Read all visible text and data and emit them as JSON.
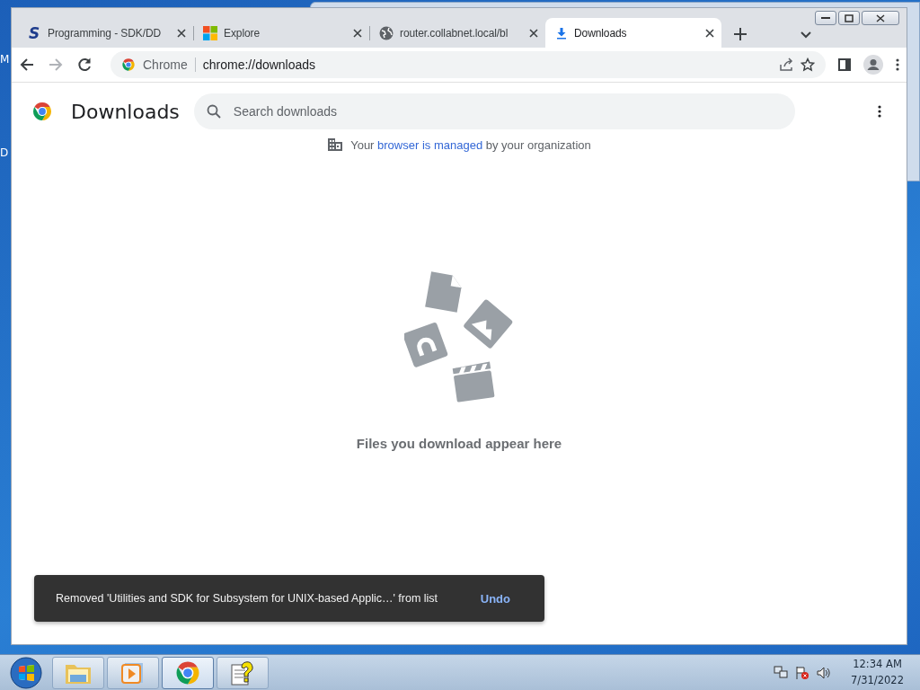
{
  "desktop": {
    "edge_labels": [
      "M",
      "D"
    ]
  },
  "window": {
    "tabs": [
      {
        "title": "Programming - SDK/DD",
        "selected": false,
        "kind": "letter",
        "icon_text": "S"
      },
      {
        "title": "Explore",
        "selected": false,
        "kind": "windows"
      },
      {
        "title": "router.collabnet.local/bl",
        "selected": false,
        "kind": "globe"
      },
      {
        "title": "Downloads",
        "selected": true,
        "kind": "download"
      }
    ],
    "nav": [
      {
        "kind": "back",
        "disabled": false
      },
      {
        "kind": "forward",
        "disabled": true
      },
      {
        "kind": "reload",
        "disabled": false
      }
    ],
    "address_bar": {
      "site_label": "Chrome",
      "url": "chrome://downloads"
    }
  },
  "page": {
    "title": "Downloads",
    "search": {
      "placeholder": "Search downloads"
    },
    "managed_notice": {
      "before": "Your",
      "link": "browser is managed",
      "after": "by your organization"
    },
    "empty_message": "Files you download appear here"
  },
  "toast": {
    "message": "Removed 'Utilities and SDK for Subsystem for UNIX-based Applic…' from list",
    "action": "Undo"
  },
  "taskbar": {
    "apps": [
      {
        "kind": "folder",
        "active": false
      },
      {
        "kind": "media",
        "active": false
      },
      {
        "kind": "chrome",
        "active": true
      },
      {
        "kind": "help",
        "active": false
      }
    ],
    "clock": {
      "time": "12:34 AM",
      "date": "7/31/2022"
    }
  }
}
